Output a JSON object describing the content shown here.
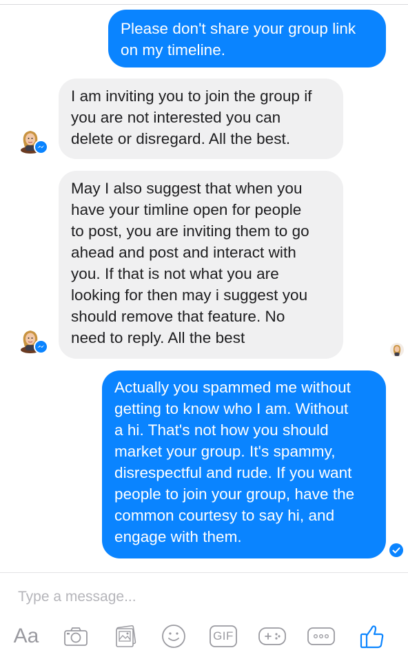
{
  "messages": [
    {
      "id": "msg1",
      "direction": "outgoing",
      "text": "Please don't share your group link\non my timeline."
    },
    {
      "id": "msg2",
      "direction": "incoming",
      "text": "I am inviting you to join the group if\nyou are not interested you can\ndelete or disregard.  All the best."
    },
    {
      "id": "msg3",
      "direction": "incoming",
      "text": "May I also suggest that when you\nhave your timline open for people\nto post, you are inviting them to go\nahead and post and interact with\nyou. If that is not what you are\nlooking for then may i suggest you\nshould remove that feature.  No\nneed to reply.  All the best"
    },
    {
      "id": "msg4",
      "direction": "outgoing",
      "text": "Actually you spammed me without\ngetting to know who I am. Without\na hi. That's not how you should\nmarket your group. It's spammy,\ndisrespectful and rude. If you want\npeople to join your group, have the\ncommon courtesy to say hi, and\nengage with them."
    }
  ],
  "composer": {
    "placeholder": "Type a message..."
  },
  "toolbar": {
    "aa_label": "Aa",
    "gif_label": "GIF",
    "icons": [
      "text-size-icon",
      "camera-icon",
      "gallery-icon",
      "emoji-icon",
      "gif-icon",
      "games-icon",
      "more-icon",
      "like-icon"
    ]
  },
  "colors": {
    "outgoing_bubble": "#0a84ff",
    "incoming_bubble": "#f0f0f1",
    "icon_gray": "#9a9aa0",
    "accent": "#0a84ff"
  }
}
